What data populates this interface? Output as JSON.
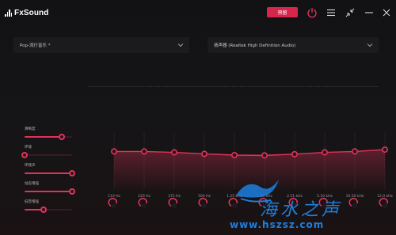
{
  "app": {
    "name": "FxSound"
  },
  "titlebar": {
    "upgrade_label": "预留",
    "icons": [
      "power-icon",
      "menu-icon",
      "shrink-icon",
      "minimize-icon",
      "close-icon"
    ]
  },
  "preset": {
    "value": "Pop-流行音乐 *"
  },
  "device": {
    "value": "扬声器 (Realtek High Definition Audio)"
  },
  "effects": [
    {
      "label": "清晰度",
      "level": 0.78
    },
    {
      "label": "环境",
      "level": 0.0
    },
    {
      "label": "环绕声",
      "level": 1.0
    },
    {
      "label": "动态增强",
      "level": 1.0
    },
    {
      "label": "低音增强",
      "level": 0.4
    }
  ],
  "eq": {
    "bands": [
      "110 Hz",
      "220 Hz",
      "375 Hz",
      "500 Hz",
      "1.25 kHz",
      "1.83 kHz",
      "2.51 kHz",
      "5.10 kHz",
      "10.50 kHz",
      "12.0 kHz"
    ],
    "gains": [
      0.6,
      0.6,
      0.45,
      0.2,
      0.0,
      -0.05,
      0.15,
      0.45,
      0.6,
      0.9
    ],
    "gain_range": [
      -6,
      6
    ]
  },
  "colors": {
    "accent": "#e0335a",
    "upgrade": "#d6264c",
    "background": "#121214"
  },
  "watermark": {
    "text": "海水之声",
    "url": "www.hszsz.com"
  }
}
